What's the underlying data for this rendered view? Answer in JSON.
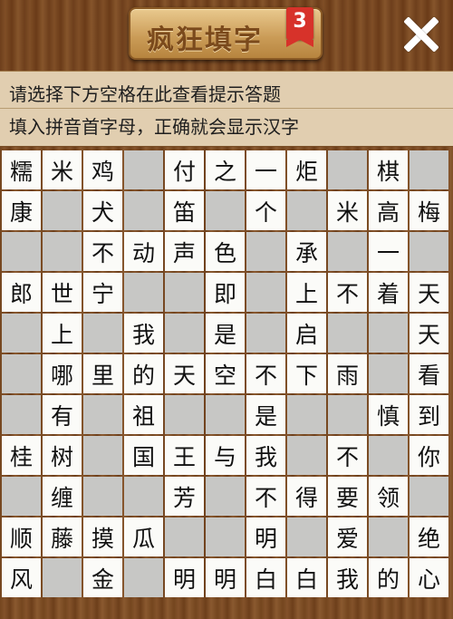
{
  "header": {
    "title": "疯狂填字",
    "level_badge": "3",
    "close_icon": "close-icon"
  },
  "hint": {
    "line1": "请选择下方空格在此查看提示答题",
    "line2": "填入拼音首字母，正确就会显示汉字"
  },
  "colors": {
    "wood_dark": "#6e3f1c",
    "hint_bg": "#e1ceb0",
    "cell_filled": "#fbfbf8",
    "cell_blank": "#c7c7c5",
    "badge_red": "#d7322a"
  },
  "grid": {
    "rows": [
      [
        "糯",
        "米",
        "鸡",
        "",
        "付",
        "之",
        "一",
        "炬",
        "",
        "棋",
        ""
      ],
      [
        "康",
        "",
        "犬",
        "",
        "笛",
        "",
        "个",
        "",
        "米",
        "高",
        "梅"
      ],
      [
        "",
        "",
        "不",
        "动",
        "声",
        "色",
        "",
        "承",
        "",
        "一",
        ""
      ],
      [
        "郎",
        "世",
        "宁",
        "",
        "",
        "即",
        "",
        "上",
        "不",
        "着",
        "天"
      ],
      [
        "",
        "上",
        "",
        "我",
        "",
        "是",
        "",
        "启",
        "",
        "",
        "天"
      ],
      [
        "",
        "哪",
        "里",
        "的",
        "天",
        "空",
        "不",
        "下",
        "雨",
        "",
        "看"
      ],
      [
        "",
        "有",
        "",
        "祖",
        "",
        "",
        "是",
        "",
        "",
        "慎",
        "到"
      ],
      [
        "桂",
        "树",
        "",
        "国",
        "王",
        "与",
        "我",
        "",
        "不",
        "",
        "你"
      ],
      [
        "",
        "缠",
        "",
        "",
        "芳",
        "",
        "不",
        "得",
        "要",
        "领",
        ""
      ],
      [
        "顺",
        "藤",
        "摸",
        "瓜",
        "",
        "",
        "明",
        "",
        "爱",
        "",
        "绝"
      ],
      [
        "风",
        "",
        "金",
        "",
        "明",
        "明",
        "白",
        "白",
        "我",
        "的",
        "心"
      ]
    ]
  }
}
